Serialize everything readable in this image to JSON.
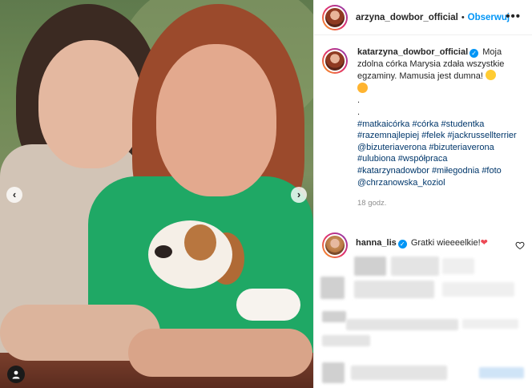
{
  "post": {
    "author": "arzyna_dowbor_official",
    "follow_label": "Obserwuj",
    "more_label": "•••",
    "photo_nav": {
      "prev": "‹",
      "next": "›"
    }
  },
  "caption": {
    "username": "katarzyna_dowbor_official",
    "text": "Moja zdolna córka Marysia zdała wszystkie egzaminy. Mamusia jest dumna!",
    "dots": [
      ".",
      "."
    ],
    "hashtags": "#matkaicórka #córka #studentka #razemnajlepiej #felek #jackrussellterrier @bizuteriaverona #bizuteriaverona #ulubiona #współpraca #katarzynadowbor #miłegodnia #foto @chrzanowska_koziol",
    "time": "18 godz."
  },
  "comments": [
    {
      "username": "hanna_lis",
      "text": "Gratki wieeeelkie!",
      "emoji": "❤"
    }
  ],
  "colors": {
    "accent": "#0095f6",
    "link": "#00376b",
    "muted": "#8e8e8e",
    "heart": "#ed4956"
  },
  "icons": [
    "verified-badge-icon",
    "more-icon",
    "heart-icon",
    "user-tag-icon",
    "chevron-left-icon",
    "chevron-right-icon"
  ]
}
